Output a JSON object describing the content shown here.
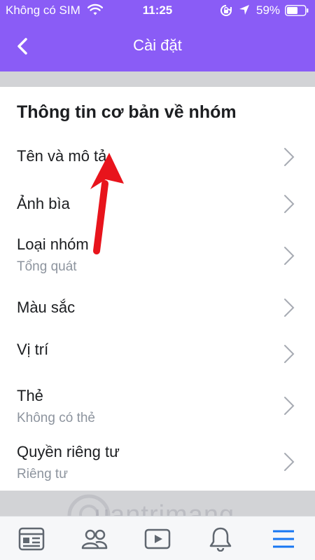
{
  "status_bar": {
    "carrier": "Không có SIM",
    "time": "11:25",
    "battery": "59%"
  },
  "nav": {
    "title": "Cài đặt",
    "back_icon": "chevron-left-icon"
  },
  "section": {
    "title": "Thông tin cơ bản về nhóm"
  },
  "settings": [
    {
      "label": "Tên và mô tả",
      "sub": ""
    },
    {
      "label": "Ảnh bìa",
      "sub": ""
    },
    {
      "label": "Loại nhóm",
      "sub": "Tổng quát"
    },
    {
      "label": "Màu sắc",
      "sub": ""
    },
    {
      "label": "Vị trí",
      "sub": ""
    },
    {
      "label": "Thẻ",
      "sub": "Không có thẻ"
    },
    {
      "label": "Quyền riêng tư",
      "sub": "Riêng tư"
    }
  ],
  "tabs": [
    {
      "icon": "news-feed-icon"
    },
    {
      "icon": "groups-icon"
    },
    {
      "icon": "video-icon"
    },
    {
      "icon": "bell-icon"
    },
    {
      "icon": "menu-icon",
      "active": true
    }
  ],
  "watermark": {
    "text": "uantrimang"
  },
  "colors": {
    "header": "#8a5cf6",
    "arrow": "#e8141c",
    "active_tab": "#1877f2"
  }
}
